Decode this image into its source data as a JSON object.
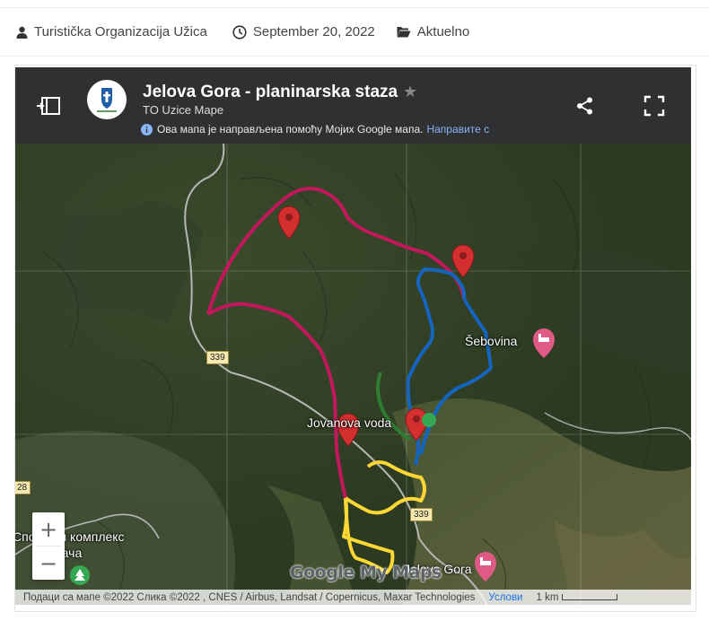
{
  "meta": {
    "author": "Turistička Organizacija Užica",
    "date": "September 20, 2022",
    "category": "Aktuelno"
  },
  "map": {
    "title": "Jelova Gora - planinarska staza",
    "subtitle": "TO Uzice Mape",
    "info_text": "Ова мапа је направљена помоћу Мојих Google мапа.",
    "info_link": "Направите с",
    "labels": {
      "sebovina": "Šebovina",
      "jovanova_voda": "Jovanova voda",
      "jelova_gora": "Jelova Gora",
      "sports_complex": "Спортски комплекс",
      "dinjaca": "Дињача"
    },
    "road_numbers": [
      "339",
      "339",
      "28"
    ],
    "brand": "Google My Maps",
    "attribution": "Подаци са мапе ©2022 Слика ©2022 , CNES / Airbus, Landsat / Copernicus, Maxar Technologies",
    "terms": "Услови",
    "scale": "1 km",
    "zoom_in": "+",
    "zoom_out": "−",
    "route_colors": {
      "magenta": "#c2185b",
      "blue": "#1565c0",
      "green": "#2e7d32",
      "yellow": "#fdd835"
    }
  }
}
